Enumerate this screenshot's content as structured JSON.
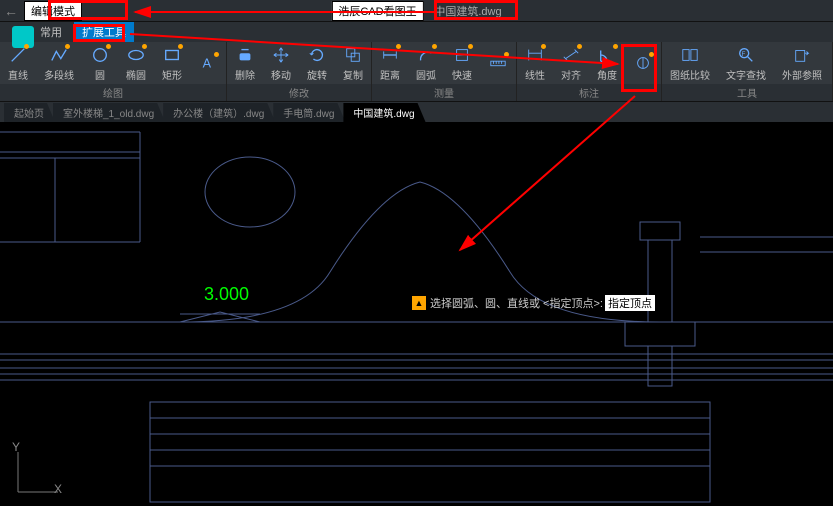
{
  "titlebar": {
    "mode_button": "编辑模式",
    "app_name": "浩辰CAD看图王",
    "file_name": "中国建筑.dwg"
  },
  "menubar": {
    "items": [
      "常用",
      "扩展工具"
    ]
  },
  "ribbon": {
    "groups": [
      {
        "label": "绘图",
        "tools": [
          {
            "name": "line",
            "label": "直线"
          },
          {
            "name": "polyline",
            "label": "多段线"
          },
          {
            "name": "circle",
            "label": "圆"
          },
          {
            "name": "ellipse",
            "label": "椭圆"
          },
          {
            "name": "rectangle",
            "label": "矩形"
          },
          {
            "name": "text",
            "label": ""
          }
        ]
      },
      {
        "label": "修改",
        "tools": [
          {
            "name": "erase",
            "label": "删除"
          },
          {
            "name": "move",
            "label": "移动"
          },
          {
            "name": "rotate",
            "label": "旋转"
          },
          {
            "name": "copy",
            "label": "复制"
          }
        ]
      },
      {
        "label": "测量",
        "tools": [
          {
            "name": "distance",
            "label": "距离"
          },
          {
            "name": "arc-measure",
            "label": "圆弧"
          },
          {
            "name": "quick",
            "label": "快速"
          },
          {
            "name": "measure",
            "label": ""
          }
        ]
      },
      {
        "label": "标注",
        "tools": [
          {
            "name": "linear",
            "label": "线性"
          },
          {
            "name": "aligned",
            "label": "对齐"
          },
          {
            "name": "angle",
            "label": "角度"
          },
          {
            "name": "annotate",
            "label": ""
          }
        ]
      },
      {
        "label": "工具",
        "tools": [
          {
            "name": "compare",
            "label": "图纸比较"
          },
          {
            "name": "findtext",
            "label": "文字查找"
          },
          {
            "name": "xref",
            "label": "外部参照"
          }
        ]
      }
    ]
  },
  "tabs": {
    "items": [
      {
        "label": "起始页",
        "active": false
      },
      {
        "label": "室外楼梯_1_old.dwg",
        "active": false
      },
      {
        "label": "办公楼（建筑）.dwg",
        "active": false
      },
      {
        "label": "手电筒.dwg",
        "active": false
      },
      {
        "label": "中国建筑.dwg",
        "active": true
      }
    ]
  },
  "canvas": {
    "dimension_value": "3.000",
    "prompt_text": "选择圆弧、圆、直线或 <指定顶点>:",
    "prompt_input": "指定顶点",
    "ucs": {
      "x": "X",
      "y": "Y"
    }
  }
}
